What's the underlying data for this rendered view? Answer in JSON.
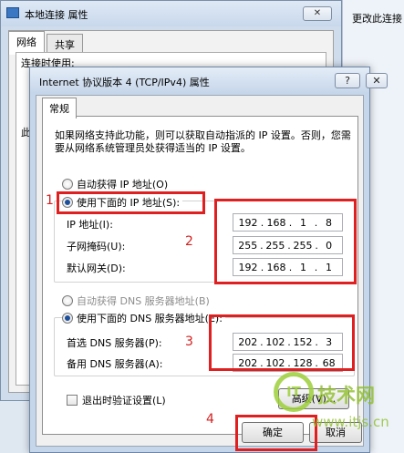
{
  "background_window": {
    "title": "本地连接 属性",
    "close_label": "✕",
    "tabs": [
      "网络",
      "共享"
    ],
    "fragment_1": "连接时使用:",
    "fragment_2": "此"
  },
  "right_strip_text": "更改此连接",
  "dialog": {
    "title": "Internet 协议版本 4 (TCP/IPv4) 属性",
    "help_label": "?",
    "close_label": "✕",
    "tab_label": "常规",
    "description": "如果网络支持此功能，则可以获取自动指派的 IP 设置。否则，您需要从网络系统管理员处获得适当的 IP 设置。",
    "ip_section": {
      "auto_label": "自动获得 IP 地址(O)",
      "manual_label": "使用下面的 IP 地址(S):",
      "selected": "manual",
      "fields": [
        {
          "label": "IP 地址(I):",
          "octets": [
            "192",
            "168",
            "1",
            "8"
          ]
        },
        {
          "label": "子网掩码(U):",
          "octets": [
            "255",
            "255",
            "255",
            "0"
          ]
        },
        {
          "label": "默认网关(D):",
          "octets": [
            "192",
            "168",
            "1",
            "1"
          ]
        }
      ]
    },
    "dns_section": {
      "auto_label": "自动获得 DNS 服务器地址(B)",
      "manual_label": "使用下面的 DNS 服务器地址(E):",
      "selected": "manual",
      "fields": [
        {
          "label": "首选 DNS 服务器(P):",
          "octets": [
            "202",
            "102",
            "152",
            "3"
          ]
        },
        {
          "label": "备用 DNS 服务器(A):",
          "octets": [
            "202",
            "102",
            "128",
            "68"
          ]
        }
      ]
    },
    "validate_label": "退出时验证设置(L)",
    "validate_checked": false,
    "advanced_label": "高级(V)...",
    "ok_label": "确定",
    "cancel_label": "取消"
  },
  "annotations": {
    "step_1": "1",
    "step_2": "2",
    "step_3": "3",
    "step_4": "4",
    "color": "#e02020"
  },
  "watermark": {
    "logo": "IT",
    "text": "技术网",
    "url": "www.itjs.cn"
  }
}
